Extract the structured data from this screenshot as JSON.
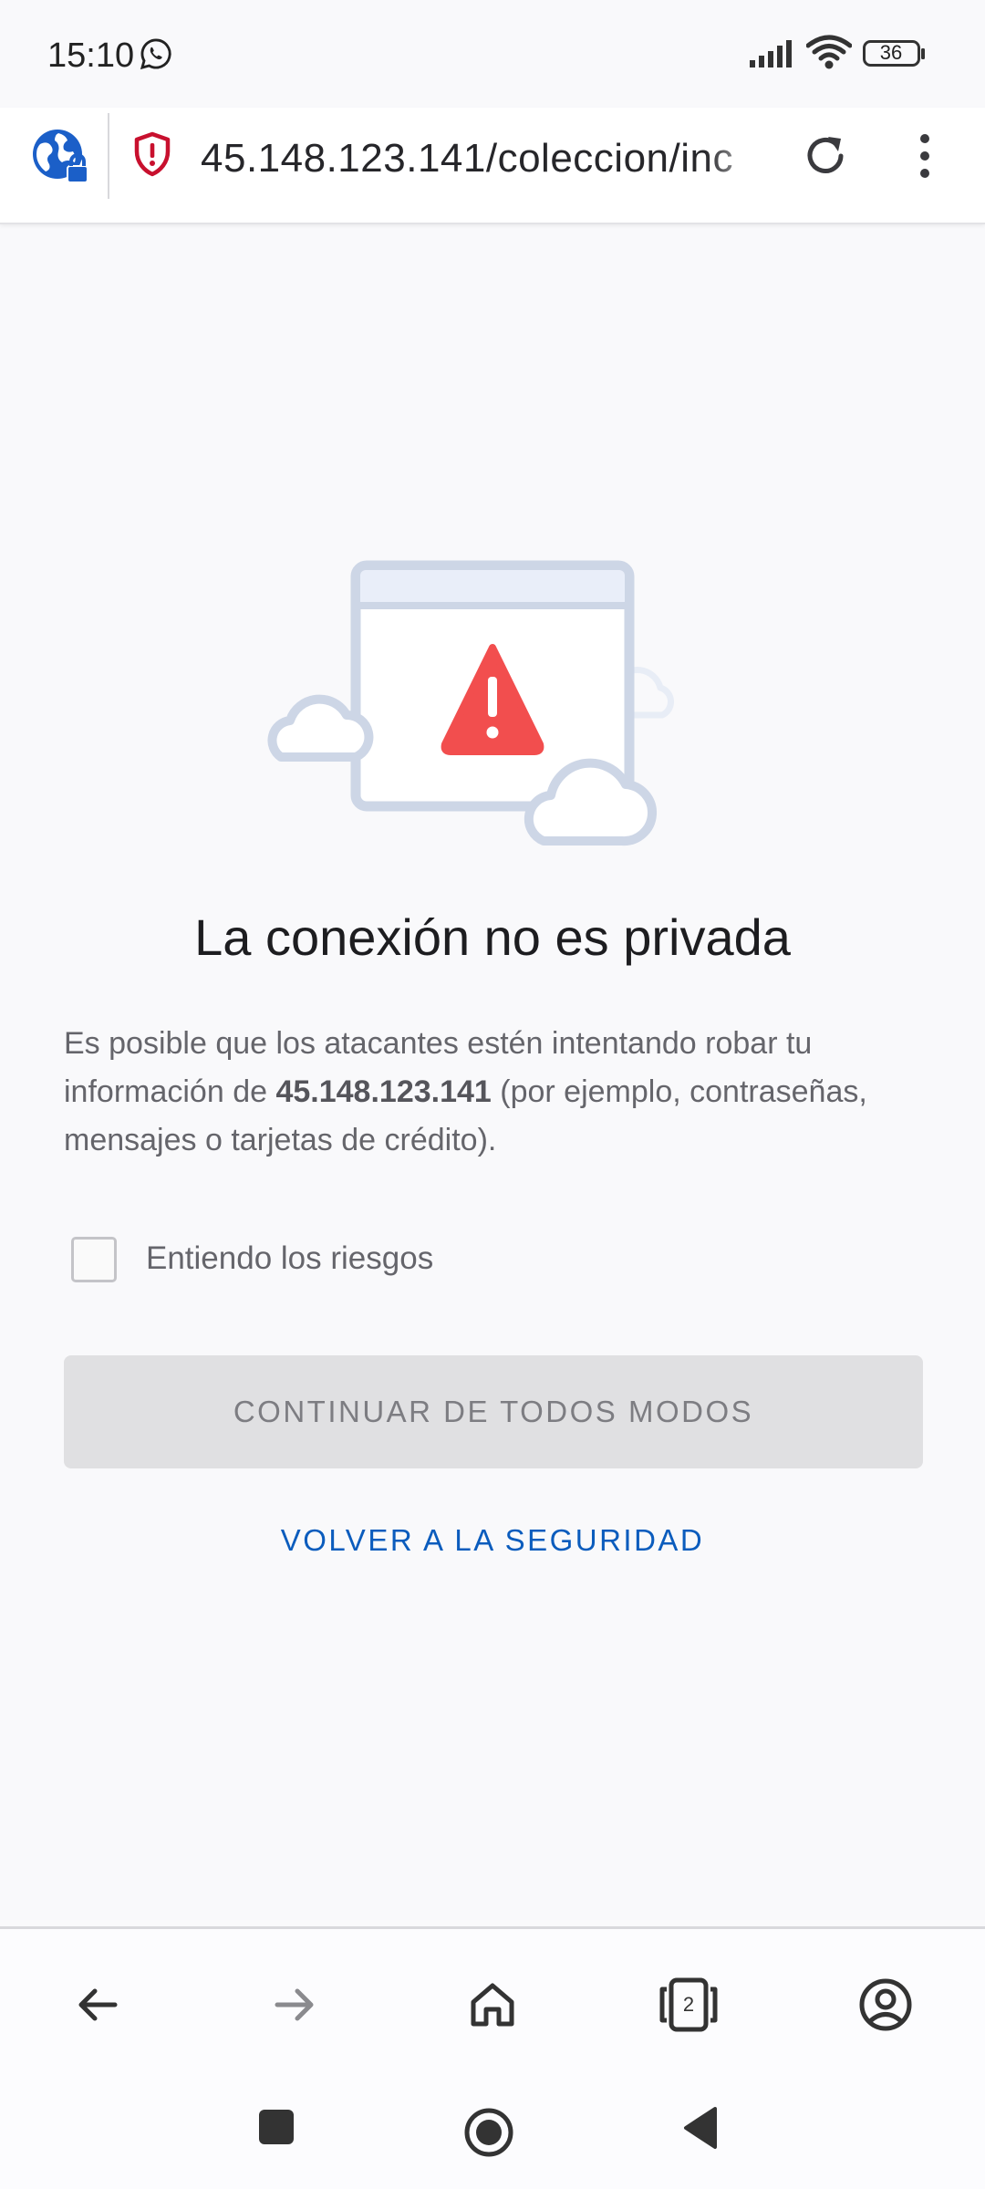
{
  "status_bar": {
    "time": "15:10",
    "battery": "36",
    "icons": [
      "whatsapp-icon",
      "signal-icon",
      "wifi-icon",
      "battery-icon"
    ]
  },
  "toolbar": {
    "url": "45.148.123.141/coleccion/inc",
    "icons": [
      "site-info-icon",
      "shield-warning-icon",
      "reload-icon",
      "more-vert-icon"
    ]
  },
  "error_page": {
    "title": "La conexión no es privada",
    "description_before": "Es posible que los atacantes estén intentando robar tu información de ",
    "description_host": "45.148.123.141",
    "description_after": " (por ejemplo, contraseñas, mensajes o tarjetas de crédito).",
    "checkbox_label": "Entiendo los riesgos",
    "checkbox_checked": false,
    "continue_label": "CONTINUAR DE TODOS MODOS",
    "back_label": "VOLVER A LA SEGURIDAD"
  },
  "bottom_bar": {
    "tab_count": "2",
    "icons": [
      "back-icon",
      "forward-icon",
      "home-icon",
      "tabs-icon",
      "account-icon"
    ]
  },
  "system_nav": {
    "icons": [
      "recents-icon",
      "home-button-icon",
      "system-back-icon"
    ]
  },
  "colors": {
    "accent": "#0b5cbd",
    "warning": "#f24e4e",
    "shield": "#c8102e"
  }
}
